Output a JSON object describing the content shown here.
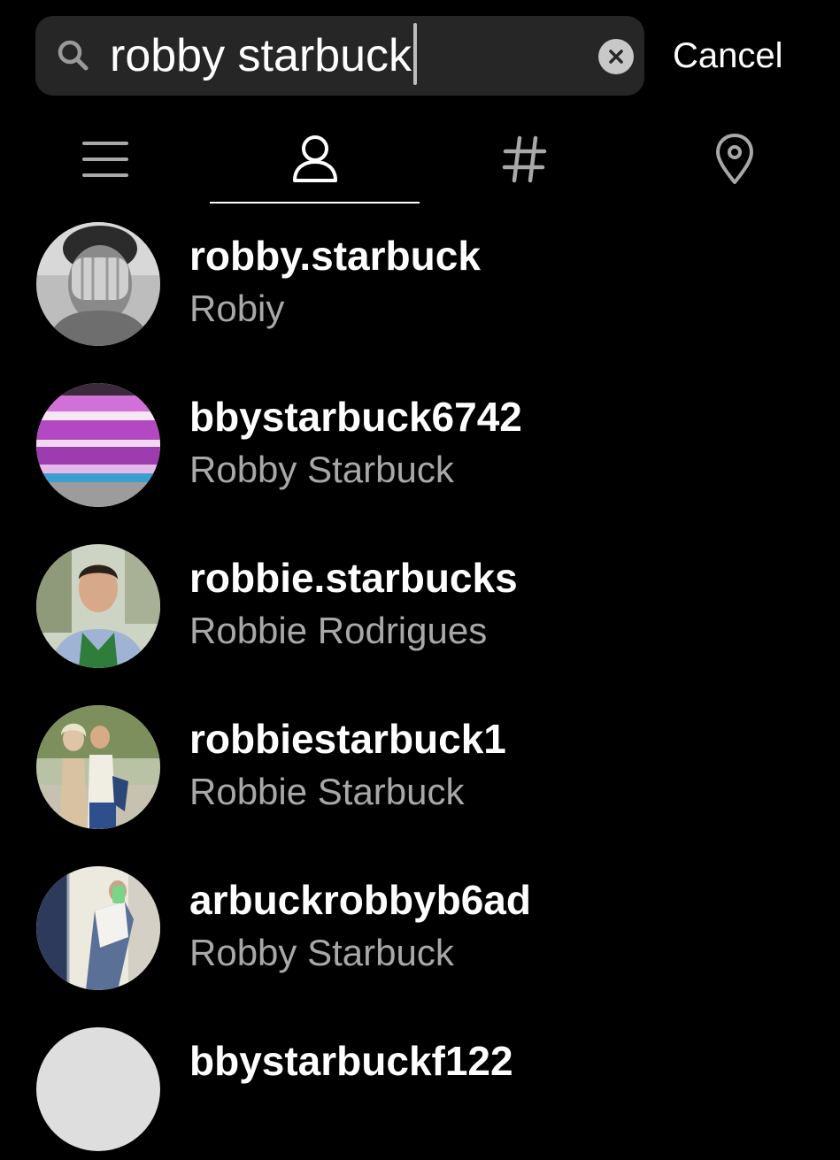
{
  "search": {
    "query": "robby starbuck",
    "cancel_label": "Cancel"
  },
  "tabs": [
    {
      "name": "top",
      "icon": "menu-icon",
      "active": false
    },
    {
      "name": "accounts",
      "icon": "person-icon",
      "active": true
    },
    {
      "name": "tags",
      "icon": "hashtag-icon",
      "active": false
    },
    {
      "name": "places",
      "icon": "location-pin-icon",
      "active": false
    }
  ],
  "results": [
    {
      "username": "robby.starbuck",
      "full_name": "Robiy"
    },
    {
      "username": "bbystarbuck6742",
      "full_name": "Robby Starbuck"
    },
    {
      "username": "robbie.starbucks",
      "full_name": "Robbie Rodrigues"
    },
    {
      "username": "robbiestarbuck1",
      "full_name": "Robbie Starbuck"
    },
    {
      "username": "arbuckrobbyb6ad",
      "full_name": "Robby Starbuck"
    },
    {
      "username": "bbystarbuckf122",
      "full_name": ""
    }
  ],
  "colors": {
    "background": "#000000",
    "search_field": "#262626",
    "secondary_text": "#a8a8a8"
  }
}
